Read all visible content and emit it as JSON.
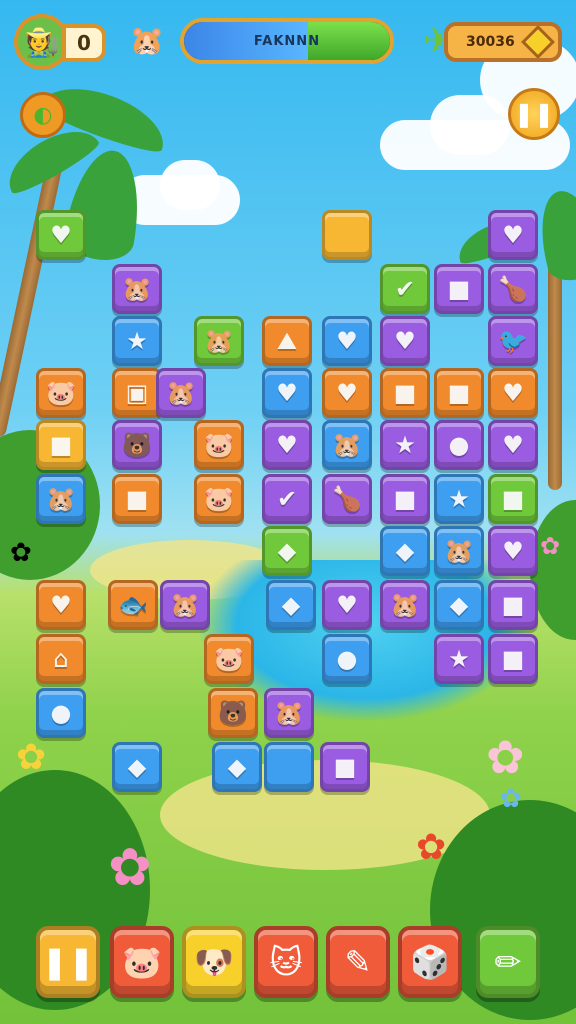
{
  "hud": {
    "avatar_icon": "explorer-avatar",
    "lives": "0",
    "pet_icon": "hamster",
    "progress_text": "FAKNNN",
    "progress_fraction": 0.6,
    "score": "30036",
    "pause_icon": "pause",
    "hint_icon": "hint"
  },
  "tiles": [
    {
      "c": "#6fc93a",
      "g": "♥",
      "n": "heart"
    },
    {
      "c": "#f7b733",
      "g": "",
      "n": "plain"
    },
    {
      "c": "#9a5ce0",
      "g": "♥",
      "n": "heart"
    },
    {
      "c": "#9a5ce0",
      "g": "🐹",
      "n": "hamster"
    },
    {
      "c": "#6fc93a",
      "g": "✔",
      "n": "check"
    },
    {
      "c": "#9a5ce0",
      "g": "■",
      "n": "square"
    },
    {
      "c": "#9a5ce0",
      "g": "🍗",
      "n": "drumstick"
    },
    {
      "c": "#3e9ef0",
      "g": "★",
      "n": "star"
    },
    {
      "c": "#6fc93a",
      "g": "🐹",
      "n": "hamster"
    },
    {
      "c": "#f08a2c",
      "g": "⛰",
      "n": "mountain"
    },
    {
      "c": "#3e9ef0",
      "g": "♥",
      "n": "heart"
    },
    {
      "c": "#9a5ce0",
      "g": "♥",
      "n": "heart"
    },
    {
      "c": "#9a5ce0",
      "g": "🐦",
      "n": "bird"
    },
    {
      "c": "#f08a2c",
      "g": "🐷",
      "n": "pig"
    },
    {
      "c": "#f08a2c",
      "g": "▣",
      "n": "box"
    },
    {
      "c": "#9a5ce0",
      "g": "🐹",
      "n": "hamster"
    },
    {
      "c": "#3e9ef0",
      "g": "♥",
      "n": "heart"
    },
    {
      "c": "#f08a2c",
      "g": "♥",
      "n": "heart"
    },
    {
      "c": "#f08a2c",
      "g": "■",
      "n": "square"
    },
    {
      "c": "#f08a2c",
      "g": "■",
      "n": "square"
    },
    {
      "c": "#f08a2c",
      "g": "♥",
      "n": "heart"
    },
    {
      "c": "#f7b733",
      "g": "■",
      "n": "square"
    },
    {
      "c": "#9a5ce0",
      "g": "🐻",
      "n": "bear"
    },
    {
      "c": "#f08a2c",
      "g": "🐷",
      "n": "pig"
    },
    {
      "c": "#9a5ce0",
      "g": "♥",
      "n": "heart"
    },
    {
      "c": "#3e9ef0",
      "g": "🐹",
      "n": "hamster"
    },
    {
      "c": "#9a5ce0",
      "g": "★",
      "n": "star"
    },
    {
      "c": "#9a5ce0",
      "g": "●",
      "n": "circle"
    },
    {
      "c": "#9a5ce0",
      "g": "♥",
      "n": "heart"
    },
    {
      "c": "#3e9ef0",
      "g": "🐹",
      "n": "hamster"
    },
    {
      "c": "#f08a2c",
      "g": "■",
      "n": "square"
    },
    {
      "c": "#f08a2c",
      "g": "🐷",
      "n": "pig"
    },
    {
      "c": "#9a5ce0",
      "g": "✔",
      "n": "check"
    },
    {
      "c": "#9a5ce0",
      "g": "🍗",
      "n": "drumstick"
    },
    {
      "c": "#9a5ce0",
      "g": "■",
      "n": "square"
    },
    {
      "c": "#3e9ef0",
      "g": "★",
      "n": "star"
    },
    {
      "c": "#6fc93a",
      "g": "■",
      "n": "square"
    },
    {
      "c": "#6fc93a",
      "g": "◆",
      "n": "leaf"
    },
    {
      "c": "#3e9ef0",
      "g": "◆",
      "n": "diamond"
    },
    {
      "c": "#3e9ef0",
      "g": "🐹",
      "n": "hamster"
    },
    {
      "c": "#9a5ce0",
      "g": "♥",
      "n": "heart"
    },
    {
      "c": "#f08a2c",
      "g": "♥",
      "n": "heart"
    },
    {
      "c": "#f08a2c",
      "g": "🐟",
      "n": "fish"
    },
    {
      "c": "#9a5ce0",
      "g": "🐹",
      "n": "hamster"
    },
    {
      "c": "#3e9ef0",
      "g": "◆",
      "n": "blob"
    },
    {
      "c": "#9a5ce0",
      "g": "♥",
      "n": "heart"
    },
    {
      "c": "#9a5ce0",
      "g": "🐹",
      "n": "hamster"
    },
    {
      "c": "#3e9ef0",
      "g": "◆",
      "n": "blob"
    },
    {
      "c": "#9a5ce0",
      "g": "■",
      "n": "square"
    },
    {
      "c": "#f08a2c",
      "g": "⌂",
      "n": "house"
    },
    {
      "c": "#f08a2c",
      "g": "🐷",
      "n": "pig"
    },
    {
      "c": "#3e9ef0",
      "g": "●",
      "n": "circle"
    },
    {
      "c": "#9a5ce0",
      "g": "★",
      "n": "star"
    },
    {
      "c": "#9a5ce0",
      "g": "■",
      "n": "square"
    },
    {
      "c": "#3e9ef0",
      "g": "●",
      "n": "circle"
    },
    {
      "c": "#f08a2c",
      "g": "🐻",
      "n": "bear"
    },
    {
      "c": "#9a5ce0",
      "g": "🐹",
      "n": "hamster"
    },
    {
      "c": "#3e9ef0",
      "g": "◆",
      "n": "leaf"
    },
    {
      "c": "#3e9ef0",
      "g": "◆",
      "n": "blob"
    },
    {
      "c": "#3e9ef0",
      "g": "",
      "n": "plain"
    },
    {
      "c": "#9a5ce0",
      "g": "■",
      "n": "square"
    }
  ],
  "dock": [
    {
      "c": "#f7b733",
      "g": "❚❚",
      "n": "pause"
    },
    {
      "c": "#f05b3a",
      "g": "🐷",
      "n": "pig"
    },
    {
      "c": "#f7d02c",
      "g": "🐶",
      "n": "dog"
    },
    {
      "c": "#f05b3a",
      "g": "🐱",
      "n": "cat"
    },
    {
      "c": "#f05b3a",
      "g": "✎",
      "n": "paintbrush"
    },
    {
      "c": "#f05b3a",
      "g": "🎲",
      "n": "dice"
    },
    {
      "c": "#6fc93a",
      "g": "✏",
      "n": "pencil"
    }
  ]
}
